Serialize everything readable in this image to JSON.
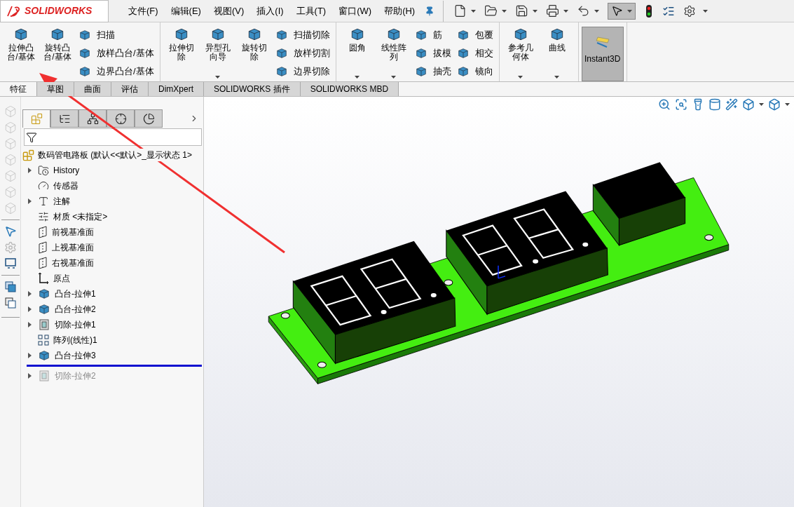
{
  "app": {
    "logo": "SOLIDWORKS"
  },
  "menu": [
    "文件(F)",
    "编辑(E)",
    "视图(V)",
    "插入(I)",
    "工具(T)",
    "窗口(W)",
    "帮助(H)"
  ],
  "ribbon": {
    "groups": [
      {
        "columns": [
          {
            "kind": "large",
            "label": "拉伸凸台/基体",
            "dropdown": false
          },
          {
            "kind": "large",
            "label": "旋转凸台/基体",
            "dropdown": false
          },
          {
            "kind": "stack",
            "items": [
              "扫描",
              "放样凸台/基体",
              "边界凸台/基体"
            ]
          }
        ]
      },
      {
        "columns": [
          {
            "kind": "large",
            "label": "拉伸切除",
            "dropdown": false
          },
          {
            "kind": "large",
            "label": "异型孔向导",
            "dropdown": true
          },
          {
            "kind": "large",
            "label": "旋转切除",
            "dropdown": false
          },
          {
            "kind": "stack",
            "items": [
              "扫描切除",
              "放样切割",
              "边界切除"
            ]
          }
        ]
      },
      {
        "columns": [
          {
            "kind": "large",
            "label": "圆角",
            "dropdown": true
          },
          {
            "kind": "large",
            "label": "线性阵列",
            "dropdown": true
          },
          {
            "kind": "stack",
            "items": [
              "筋",
              "拔模",
              "抽壳"
            ]
          },
          {
            "kind": "stack",
            "items": [
              "包覆",
              "相交",
              "镜向"
            ]
          }
        ]
      },
      {
        "columns": [
          {
            "kind": "large",
            "label": "参考几何体",
            "dropdown": true
          },
          {
            "kind": "large",
            "label": "曲线",
            "dropdown": true
          }
        ]
      },
      {
        "columns": [
          {
            "kind": "toggle",
            "label": "Instant3D",
            "selected": true
          }
        ]
      }
    ]
  },
  "command_tabs": [
    {
      "label": "特征",
      "selected": true
    },
    {
      "label": "草图",
      "selected": false
    },
    {
      "label": "曲面",
      "selected": false
    },
    {
      "label": "评估",
      "selected": false
    },
    {
      "label": "DimXpert",
      "selected": false
    },
    {
      "label": "SOLIDWORKS 插件",
      "selected": false
    },
    {
      "label": "SOLIDWORKS MBD",
      "selected": false
    }
  ],
  "panel_tabs": [
    {
      "selected": true
    },
    {
      "selected": false
    },
    {
      "selected": false
    },
    {
      "selected": false
    },
    {
      "selected": false
    }
  ],
  "tree": {
    "root": "数码管电路板  (默认<<默认>_显示状态 1>",
    "items": [
      {
        "kind": "history",
        "label": "History",
        "has_children": true,
        "rolled_back": false
      },
      {
        "kind": "sensor",
        "label": "传感器",
        "has_children": false,
        "rolled_back": false
      },
      {
        "kind": "annotation",
        "label": "注解",
        "has_children": true,
        "rolled_back": false
      },
      {
        "kind": "material",
        "label": "材质 <未指定>",
        "has_children": false,
        "rolled_back": false
      },
      {
        "kind": "plane",
        "label": "前视基准面",
        "has_children": false,
        "rolled_back": false
      },
      {
        "kind": "plane",
        "label": "上视基准面",
        "has_children": false,
        "rolled_back": false
      },
      {
        "kind": "plane",
        "label": "右视基准面",
        "has_children": false,
        "rolled_back": false
      },
      {
        "kind": "origin",
        "label": "原点",
        "has_children": false,
        "rolled_back": false
      },
      {
        "kind": "boss",
        "label": "凸台-拉伸1",
        "has_children": true,
        "rolled_back": false
      },
      {
        "kind": "boss",
        "label": "凸台-拉伸2",
        "has_children": true,
        "rolled_back": false
      },
      {
        "kind": "cut",
        "label": "切除-拉伸1",
        "has_children": true,
        "rolled_back": false
      },
      {
        "kind": "pattern",
        "label": "阵列(线性)1",
        "has_children": false,
        "rolled_back": false
      },
      {
        "kind": "boss",
        "label": "凸台-拉伸3",
        "has_children": true,
        "rolled_back": false
      },
      {
        "kind": "rollback_bar"
      },
      {
        "kind": "cut",
        "label": "切除-拉伸2",
        "has_children": true,
        "rolled_back": true
      }
    ]
  }
}
